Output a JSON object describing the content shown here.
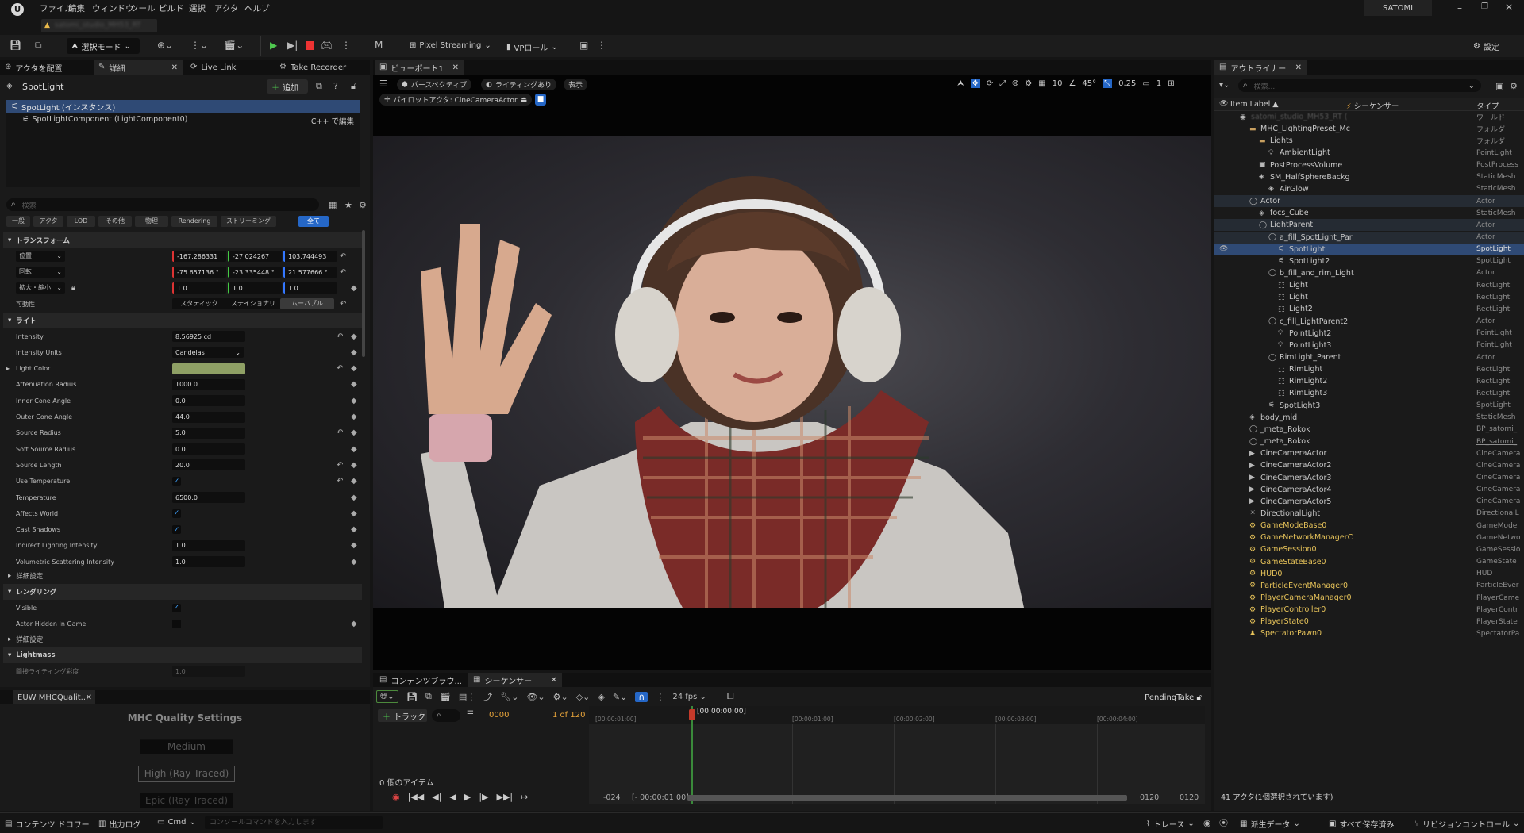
{
  "app": {
    "user": "SATOMI",
    "project_tab": "satomi_studio_MH53_RT"
  },
  "menu": [
    "ファイル",
    "編集",
    "ウィンドウ",
    "ツール",
    "ビルド",
    "選択",
    "アクタ",
    "ヘルプ"
  ],
  "toolbar": {
    "select_mode": "選択モード",
    "pixel_streaming": "Pixel Streaming",
    "vp_role": "VPロール",
    "settings": "設定"
  },
  "left_tabs": {
    "place_actors": "アクタを配置",
    "details": "詳細",
    "live_link": "Live Link",
    "take_recorder": "Take Recorder"
  },
  "details": {
    "title": "SpotLight",
    "add": "追加",
    "instance": "SpotLight (インスタンス)",
    "component": "SpotLightComponent (LightComponent0)",
    "cpp_edit": "C++ で編集",
    "search_placeholder": "検索",
    "filters": [
      "一般",
      "アクタ",
      "LOD",
      "その他",
      "物理",
      "Rendering",
      "ストリーミング",
      "全て"
    ],
    "transform": {
      "header": "トランスフォーム",
      "location_label": "位置",
      "rotation_label": "回転",
      "scale_label": "拡大・縮小",
      "location": [
        "-167.286331",
        "-27.024267",
        "103.744493"
      ],
      "rotation": [
        "-75.657136 °",
        "-23.335448 °",
        "21.577666 °"
      ],
      "scale": [
        "1.0",
        "1.0",
        "1.0"
      ],
      "mobility_label": "可動性",
      "mobility": [
        "スタティック",
        "ステイショナリ",
        "ムーバブル"
      ]
    },
    "light_header": "ライト",
    "light_props": [
      {
        "label": "Intensity",
        "value": "8.56925 cd"
      },
      {
        "label": "Intensity Units",
        "value": "Candelas"
      },
      {
        "label": "Light Color",
        "value": ""
      },
      {
        "label": "Attenuation Radius",
        "value": "1000.0"
      },
      {
        "label": "Inner Cone Angle",
        "value": "0.0"
      },
      {
        "label": "Outer Cone Angle",
        "value": "44.0"
      },
      {
        "label": "Source Radius",
        "value": "5.0"
      },
      {
        "label": "Soft Source Radius",
        "value": "0.0"
      },
      {
        "label": "Source Length",
        "value": "20.0"
      },
      {
        "label": "Use Temperature",
        "value": ""
      },
      {
        "label": "Temperature",
        "value": "6500.0"
      },
      {
        "label": "Affects World",
        "value": ""
      },
      {
        "label": "Cast Shadows",
        "value": ""
      },
      {
        "label": "Indirect Lighting Intensity",
        "value": "1.0"
      },
      {
        "label": "Volumetric Scattering Intensity",
        "value": "1.0"
      }
    ],
    "light_color": "#8fa065",
    "advanced": "詳細設定",
    "rendering_header": "レンダリング",
    "visible_label": "Visible",
    "hidden_in_game_label": "Actor Hidden In Game",
    "lightmass_header": "Lightmass",
    "indirect_label": "間接ライティング彩度",
    "indirect_value": "1.0"
  },
  "euw": {
    "tab": "EUW MHCQualit...",
    "title": "MHC Quality Settings",
    "options": [
      "Medium",
      "High (Ray Traced)",
      "Epic (Ray Traced)"
    ]
  },
  "viewport": {
    "tab": "ビューポート1",
    "perspective": "パースペクティブ",
    "lit": "ライティングあり",
    "show": "表示",
    "pilot": "パイロットアクタ: CineCameraActor",
    "grid": "10",
    "angle": "45°",
    "scale": "0.25",
    "camera_speed": "1"
  },
  "sequencer": {
    "content_browser_tab": "コンテンツブラウ...",
    "sequencer_tab": "シーケンサー",
    "fps": "24 fps",
    "take": "PendingTake",
    "track": "トラック",
    "frame": "0000",
    "frame_of": "1 of 120",
    "current_time": "[00:00:00:00]",
    "ruler": [
      "[00:00:01:00]",
      "[00:00:01:00]",
      "[00:00:02:00]",
      "[00:00:03:00]",
      "[00:00:04:00]"
    ],
    "items": "0 個のアイテム",
    "start": "-024",
    "start_time": "[- 00:00:01:00]",
    "end1": "0120",
    "end2": "0120"
  },
  "outliner": {
    "tab": "アウトライナー",
    "search_placeholder": "検索...",
    "col_label": "Item Label ▲",
    "col_sequencer": "シーケンサー",
    "col_type": "タイプ",
    "rows": [
      {
        "name": "satomi_studio_MH53_RT (",
        "type": "ワールド",
        "indent": 0,
        "icon": "world-icon"
      },
      {
        "name": "MHC_LightingPreset_Mc",
        "type": "フォルダ",
        "indent": 1,
        "icon": "folder-icon"
      },
      {
        "name": "Lights",
        "type": "フォルダ",
        "indent": 2,
        "icon": "folder-icon"
      },
      {
        "name": "AmbientLight",
        "type": "PointLight",
        "indent": 3,
        "icon": "bulb-icon"
      },
      {
        "name": "PostProcessVolume",
        "type": "PostProcess",
        "indent": 2,
        "icon": "volume-icon"
      },
      {
        "name": "SM_HalfSphereBackg",
        "type": "StaticMesh",
        "indent": 2,
        "icon": "mesh-icon"
      },
      {
        "name": "AirGlow",
        "type": "StaticMesh",
        "indent": 3,
        "icon": "mesh-icon"
      },
      {
        "name": "Actor",
        "type": "Actor",
        "indent": 1,
        "icon": "actor-icon"
      },
      {
        "name": "focs_Cube",
        "type": "StaticMesh",
        "indent": 2,
        "icon": "mesh-icon"
      },
      {
        "name": "LightParent",
        "type": "Actor",
        "indent": 2,
        "icon": "actor-icon"
      },
      {
        "name": "a_fill_SpotLight_Par",
        "type": "Actor",
        "indent": 3,
        "icon": "actor-icon"
      },
      {
        "name": "SpotLight",
        "type": "SpotLight",
        "indent": 4,
        "icon": "spotlight-icon"
      },
      {
        "name": "SpotLight2",
        "type": "SpotLight",
        "indent": 4,
        "icon": "spotlight-icon"
      },
      {
        "name": "b_fill_and_rim_Light",
        "type": "Actor",
        "indent": 3,
        "icon": "actor-icon"
      },
      {
        "name": "Light",
        "type": "RectLight",
        "indent": 4,
        "icon": "rectlight-icon"
      },
      {
        "name": "Light",
        "type": "RectLight",
        "indent": 4,
        "icon": "rectlight-icon"
      },
      {
        "name": "Light2",
        "type": "RectLight",
        "indent": 4,
        "icon": "rectlight-icon"
      },
      {
        "name": "c_fill_LightParent2",
        "type": "Actor",
        "indent": 3,
        "icon": "actor-icon"
      },
      {
        "name": "PointLight2",
        "type": "PointLight",
        "indent": 4,
        "icon": "bulb-icon"
      },
      {
        "name": "PointLight3",
        "type": "PointLight",
        "indent": 4,
        "icon": "bulb-icon"
      },
      {
        "name": "RimLight_Parent",
        "type": "Actor",
        "indent": 3,
        "icon": "actor-icon"
      },
      {
        "name": "RimLight",
        "type": "RectLight",
        "indent": 4,
        "icon": "rectlight-icon"
      },
      {
        "name": "RimLight2",
        "type": "RectLight",
        "indent": 4,
        "icon": "rectlight-icon"
      },
      {
        "name": "RimLight3",
        "type": "RectLight",
        "indent": 4,
        "icon": "rectlight-icon"
      },
      {
        "name": "SpotLight3",
        "type": "SpotLight",
        "indent": 3,
        "icon": "spotlight-icon"
      },
      {
        "name": "body_mid",
        "type": "StaticMesh",
        "indent": 1,
        "icon": "mesh-icon"
      },
      {
        "name": "_meta_Rokok",
        "type": "BP_satomi_",
        "indent": 1,
        "icon": "actor-icon",
        "link": true
      },
      {
        "name": "_meta_Rokok",
        "type": "BP_satomi_",
        "indent": 1,
        "icon": "actor-icon",
        "link": true
      },
      {
        "name": "CineCameraActor",
        "type": "CineCamera",
        "indent": 1,
        "icon": "camera-icon"
      },
      {
        "name": "CineCameraActor2",
        "type": "CineCamera",
        "indent": 1,
        "icon": "camera-icon"
      },
      {
        "name": "CineCameraActor3",
        "type": "CineCamera",
        "indent": 1,
        "icon": "camera-icon"
      },
      {
        "name": "CineCameraActor4",
        "type": "CineCamera",
        "indent": 1,
        "icon": "camera-icon"
      },
      {
        "name": "CineCameraActor5",
        "type": "CineCamera",
        "indent": 1,
        "icon": "camera-icon"
      },
      {
        "name": "DirectionalLight",
        "type": "DirectionalL",
        "indent": 1,
        "icon": "sun-icon"
      },
      {
        "name": "GameModeBase0",
        "type": "GameMode",
        "indent": 1,
        "icon": "gear-icon",
        "yellow": true
      },
      {
        "name": "GameNetworkManagerC",
        "type": "GameNetwo",
        "indent": 1,
        "icon": "gear-icon",
        "yellow": true
      },
      {
        "name": "GameSession0",
        "type": "GameSessio",
        "indent": 1,
        "icon": "gear-icon",
        "yellow": true
      },
      {
        "name": "GameStateBase0",
        "type": "GameState",
        "indent": 1,
        "icon": "gear-icon",
        "yellow": true
      },
      {
        "name": "HUD0",
        "type": "HUD",
        "indent": 1,
        "icon": "gear-icon",
        "yellow": true
      },
      {
        "name": "ParticleEventManager0",
        "type": "ParticleEver",
        "indent": 1,
        "icon": "gear-icon",
        "yellow": true
      },
      {
        "name": "PlayerCameraManager0",
        "type": "PlayerCame",
        "indent": 1,
        "icon": "gear-icon",
        "yellow": true
      },
      {
        "name": "PlayerController0",
        "type": "PlayerContr",
        "indent": 1,
        "icon": "gear-icon",
        "yellow": true
      },
      {
        "name": "PlayerState0",
        "type": "PlayerState",
        "indent": 1,
        "icon": "gear-icon",
        "yellow": true
      },
      {
        "name": "SpectatorPawn0",
        "type": "SpectatorPa",
        "indent": 1,
        "icon": "pawn-icon",
        "yellow": true
      }
    ],
    "status": "41 アクタ(1個選択されています)"
  },
  "statusbar": {
    "content_drawer": "コンテンツ ドロワー",
    "output_log": "出力ログ",
    "cmd": "Cmd",
    "console_placeholder": "コンソールコマンドを入力します",
    "trace": "トレース",
    "derived_data": "派生データ",
    "save_all": "すべて保存済み",
    "revision": "リビジョンコントロール"
  }
}
